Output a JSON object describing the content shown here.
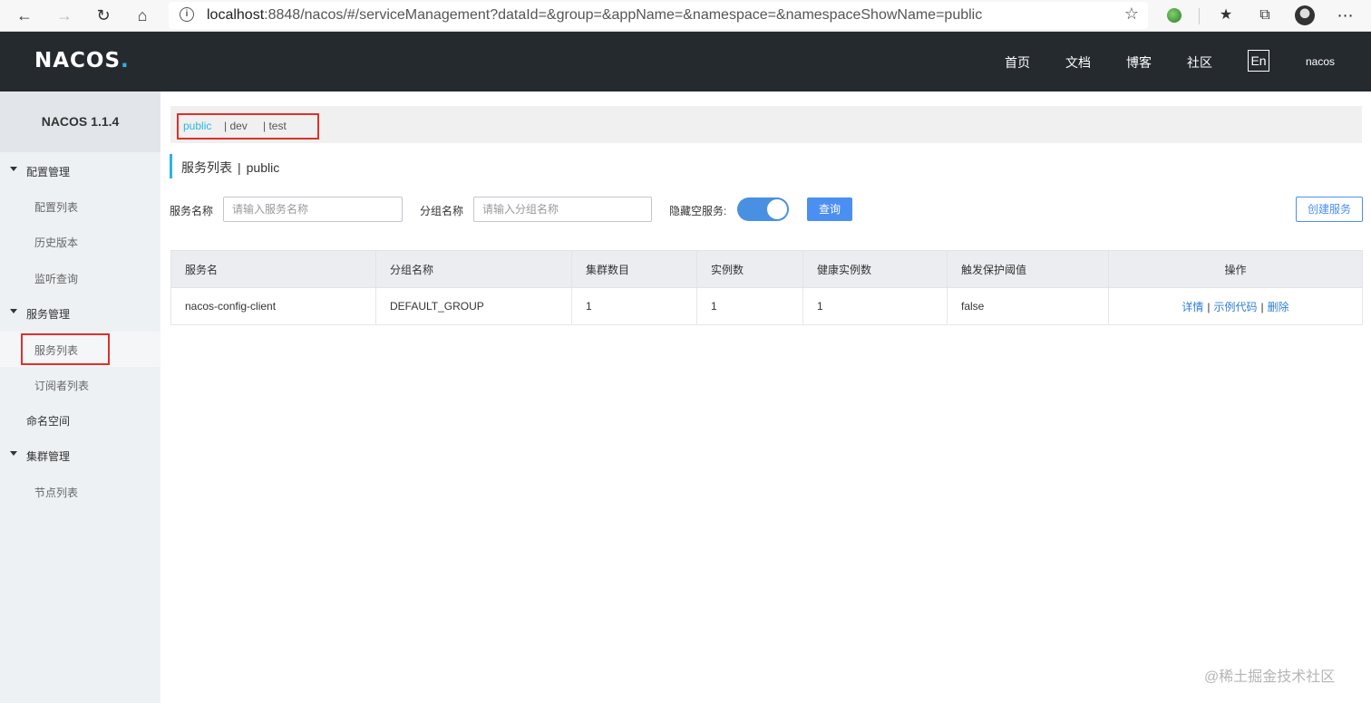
{
  "browser": {
    "url_host": "localhost",
    "url_rest": ":8848/nacos/#/serviceManagement?dataId=&group=&appName=&namespace=&namespaceShowName=public",
    "icons": [
      "back-icon",
      "forward-icon",
      "refresh-icon",
      "home-icon",
      "info-icon",
      "star-icon",
      "extension-icon",
      "favorites-icon",
      "collections-icon",
      "profile-icon",
      "more-icon"
    ]
  },
  "header": {
    "logo_prefix": "NACOS",
    "logo_dot": ".",
    "nav": [
      "首页",
      "文档",
      "博客",
      "社区"
    ],
    "lang": "En",
    "user": "nacos"
  },
  "sidebar": {
    "title": "NACOS 1.1.4",
    "groups": [
      {
        "label": "配置管理",
        "items": [
          "配置列表",
          "历史版本",
          "监听查询"
        ]
      },
      {
        "label": "服务管理",
        "items": [
          "服务列表",
          "订阅者列表"
        ]
      },
      {
        "label": "命名空间"
      },
      {
        "label": "集群管理",
        "items": [
          "节点列表"
        ]
      }
    ],
    "active_item": "服务列表"
  },
  "namespaces": {
    "items": [
      "public",
      "| dev",
      "| test"
    ],
    "active": "public"
  },
  "page": {
    "title": "服务列表",
    "separator": "|",
    "namespace": "public"
  },
  "filters": {
    "service_label": "服务名称",
    "service_placeholder": "请输入服务名称",
    "group_label": "分组名称",
    "group_placeholder": "请输入分组名称",
    "hide_empty_label": "隐藏空服务:",
    "hide_empty_on": true,
    "query_button": "查询",
    "create_button": "创建服务"
  },
  "table": {
    "columns": [
      "服务名",
      "分组名称",
      "集群数目",
      "实例数",
      "健康实例数",
      "触发保护阈值",
      "操作"
    ],
    "rows": [
      {
        "service": "nacos-config-client",
        "group": "DEFAULT_GROUP",
        "clusters": "1",
        "instances": "1",
        "healthy": "1",
        "threshold": "false",
        "ops": [
          "详情",
          "示例代码",
          "删除"
        ],
        "sep": "|"
      }
    ]
  },
  "watermark": "@稀土掘金技术社区",
  "colors": {
    "accent": "#2bb4e6",
    "primary": "#4b8ff2",
    "highlight": "#e0302a",
    "header_bg": "#252a2f"
  }
}
